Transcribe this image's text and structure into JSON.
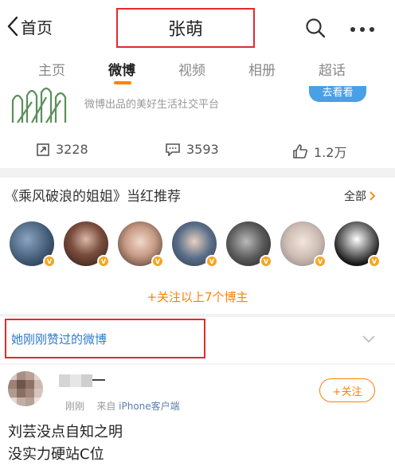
{
  "header": {
    "back_label": "首页",
    "title": "张萌"
  },
  "tabs": [
    "主页",
    "微博",
    "视频",
    "相册",
    "超话"
  ],
  "active_tab": "微博",
  "card": {
    "description": "微博出品的美好生活社交平台",
    "button_label": "去看看",
    "stats": {
      "reposts": "3228",
      "comments": "3593",
      "likes": "1.2万"
    }
  },
  "recommend": {
    "title": "《乘风破浪的姐姐》当红推荐",
    "all_label": "全部",
    "follow_all_label": "+关注以上7个博主",
    "avatar_count": 7
  },
  "liked": {
    "title": "她刚刚赞过的微博"
  },
  "post": {
    "time": "刚刚",
    "source_prefix": "来自",
    "source": "iPhone客户端",
    "follow_label": "+关注",
    "lines": [
      "刘芸没点自知之明",
      "没实力硬站C位"
    ]
  },
  "colors": {
    "accent": "#ff8200",
    "highlight_box": "#e12b2b",
    "link_blue": "#2e7bd1",
    "verified_badge": "#f5a623"
  }
}
